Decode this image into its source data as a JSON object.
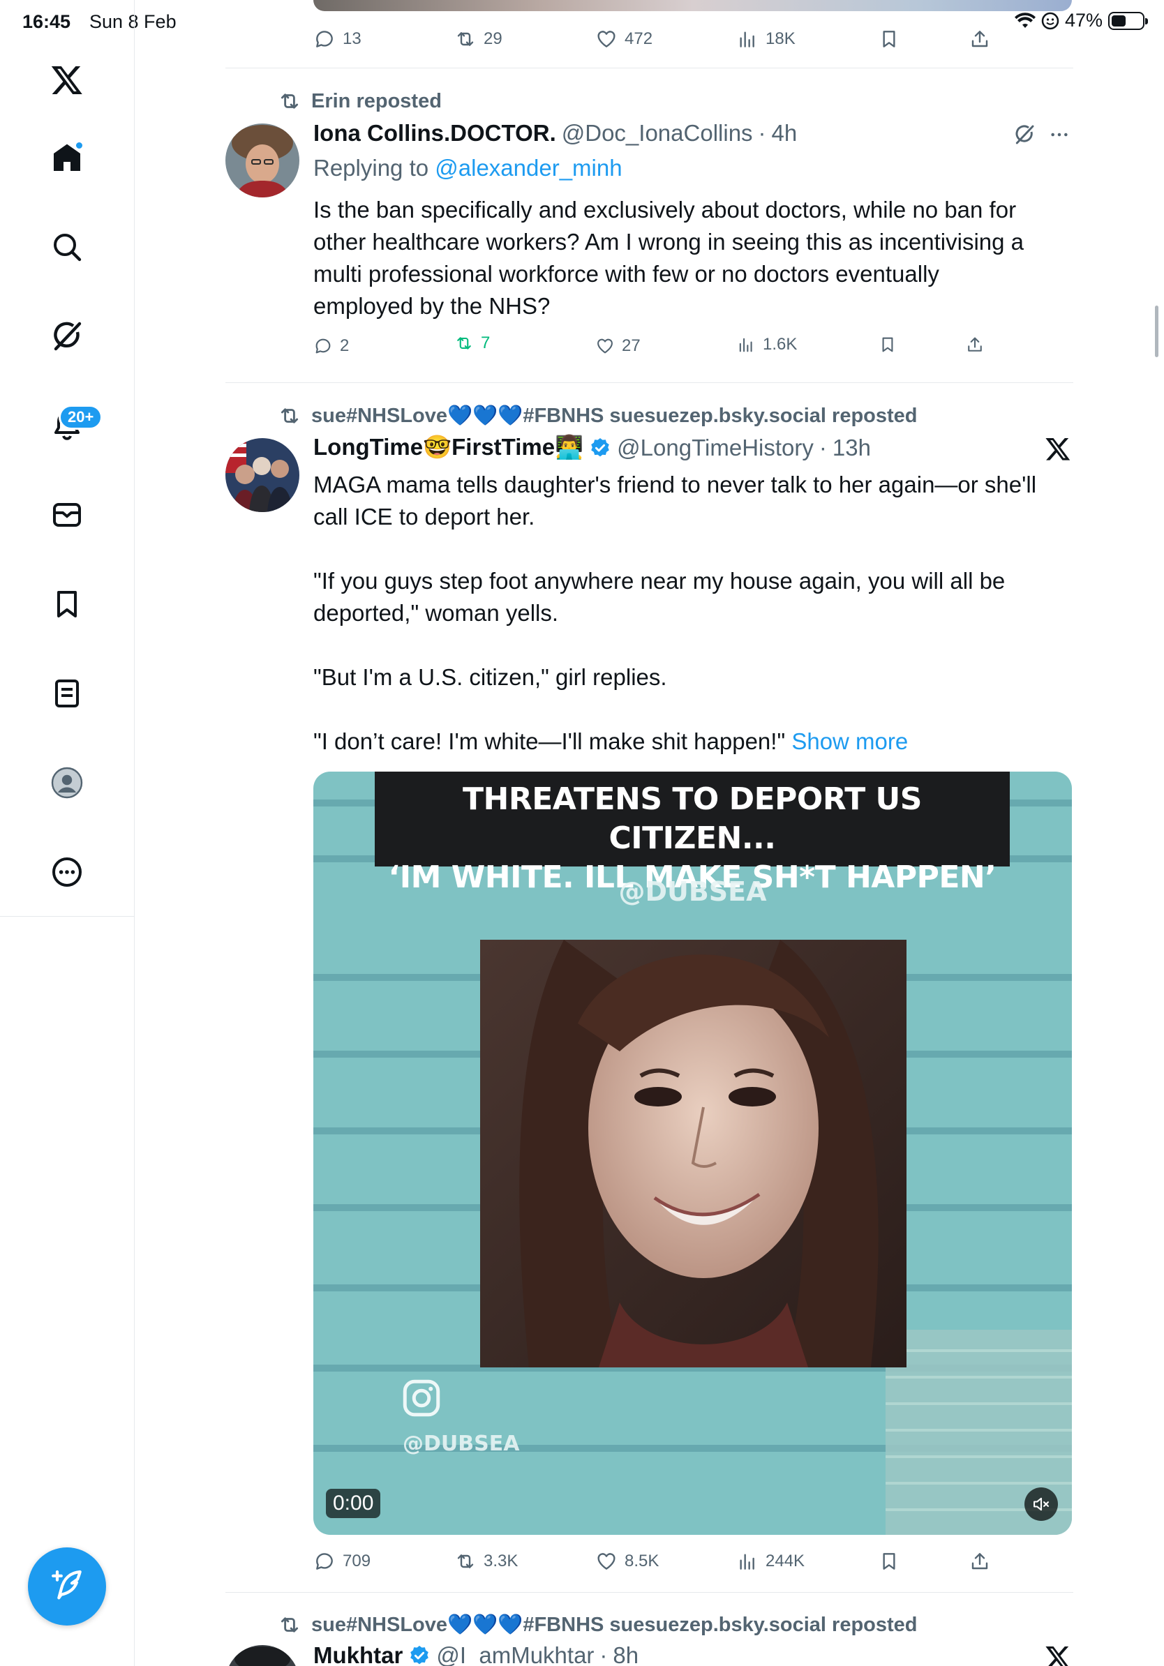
{
  "status_bar": {
    "time": "16:45",
    "date": "Sun 8 Feb",
    "battery": "47%",
    "battery_level": 0.47
  },
  "sidebar": {
    "notification_badge": "20+",
    "items": [
      {
        "name": "x-logo-icon"
      },
      {
        "name": "home-icon"
      },
      {
        "name": "search-icon"
      },
      {
        "name": "grok-icon"
      },
      {
        "name": "notifications-icon"
      },
      {
        "name": "messages-icon"
      },
      {
        "name": "bookmarks-icon"
      },
      {
        "name": "lists-icon"
      },
      {
        "name": "profile-icon"
      },
      {
        "name": "more-icon"
      }
    ],
    "compose_icon": "compose-icon"
  },
  "top_tweet": {
    "replies": "13",
    "reposts": "29",
    "likes": "472",
    "views": "18K"
  },
  "tweets": [
    {
      "repost_label": "Erin reposted",
      "display_name": "Iona Collins.DOCTOR.",
      "handle": "@Doc_IonaCollins",
      "dot": "·",
      "time": "4h",
      "reply_prefix": "Replying to ",
      "reply_to": "@alexander_minh",
      "text": "Is the ban specifically and exclusively about doctors, while no ban for\nother healthcare workers? Am I wrong in seeing this as incentivising a\nmulti professional workforce with few or no doctors eventually\nemployed by the NHS?",
      "replies": "2",
      "reposts": "7",
      "likes": "27",
      "views": "1.6K",
      "retweeted": true
    },
    {
      "repost_label": "sue#NHSLove💙💙💙#FBNHS suesuezep.bsky.social reposted",
      "display_name": "LongTime🤓FirstTime👨‍💻",
      "handle": "@LongTimeHistory",
      "dot": "·",
      "time": "13h",
      "text": "MAGA mama tells daughter's friend to never talk to her again—or she'll\ncall ICE to deport her.\n\n\"If you guys step foot anywhere near my house again, you will all be\ndeported,\" woman yells.\n\n\"But I'm a U.S. citizen,\" girl replies.\n\n\"I don’t care! I'm white—I'll make shit happen!\" ",
      "show_more": "Show more",
      "video": {
        "title_line1": "THREATENS TO DEPORT US CITIZEN...",
        "title_line2": "‘IM WHITE. ILL MAKE SH*T HAPPEN’",
        "watermark_top": "@DUBSEA",
        "watermark_bottom": "@DUBSEA",
        "time": "0:00"
      },
      "replies": "709",
      "reposts": "3.3K",
      "likes": "8.5K",
      "views": "244K"
    },
    {
      "repost_label": "sue#NHSLove💙💙💙#FBNHS suesuezep.bsky.social reposted",
      "display_name": "Mukhtar",
      "handle": "@I_amMukhtar",
      "dot": "·",
      "time": "8h"
    }
  ]
}
